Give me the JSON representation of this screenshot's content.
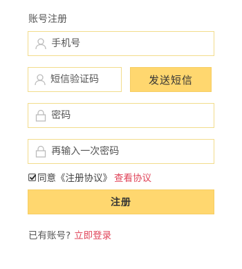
{
  "form": {
    "title": "账号注册",
    "phone_placeholder": "手机号",
    "sms_code_placeholder": "短信验证码",
    "send_code_label": "发送短信",
    "password_placeholder": "密码",
    "confirm_password_placeholder": "再输入一次密码",
    "agree_checked": true,
    "agree_text": "同意《注册协议》",
    "view_agreement_label": "查看协议",
    "submit_label": "注册",
    "has_account_text": "已有账号?",
    "login_link_label": "立即登录"
  },
  "icons": {
    "phone_field": "user-icon",
    "sms_field": "user-icon",
    "password_field": "lock-icon",
    "confirm_field": "lock-icon"
  },
  "colors": {
    "accent": "#ffd76f",
    "border": "#f2dc8a",
    "link": "#e0455a",
    "icon": "#bbbbbb"
  }
}
